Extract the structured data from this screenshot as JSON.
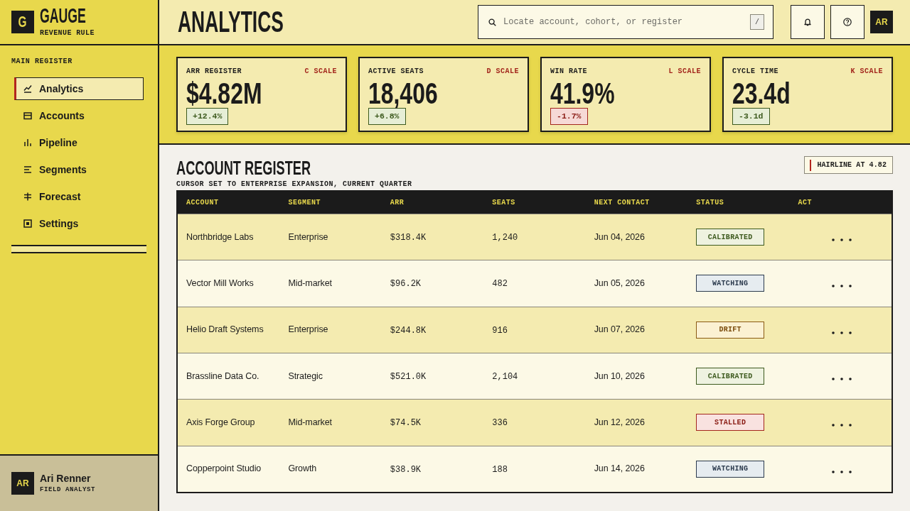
{
  "brand": {
    "logo_letter": "G",
    "name": "GAUGE",
    "tagline": "REVENUE RULE"
  },
  "sidebar": {
    "section_label": "MAIN REGISTER",
    "items": [
      {
        "label": "Analytics",
        "selected": true
      },
      {
        "label": "Accounts",
        "selected": false
      },
      {
        "label": "Pipeline",
        "selected": false
      },
      {
        "label": "Segments",
        "selected": false
      },
      {
        "label": "Forecast",
        "selected": false
      },
      {
        "label": "Settings",
        "selected": false
      }
    ]
  },
  "user": {
    "initials": "AR",
    "name": "Ari Renner",
    "role": "FIELD ANALYST"
  },
  "header": {
    "title": "ANALYTICS",
    "search": {
      "placeholder": "Locate account, cohort, or register",
      "shortcut": "/"
    },
    "avatar_initials": "AR"
  },
  "kpis": [
    {
      "label": "ARR REGISTER",
      "scale": "C SCALE",
      "value": "$4.82M",
      "delta": {
        "text": "+12.4%",
        "kind": "good"
      }
    },
    {
      "label": "ACTIVE SEATS",
      "scale": "D SCALE",
      "value": "18,406",
      "delta": {
        "text": "+6.8%",
        "kind": "good"
      }
    },
    {
      "label": "WIN RATE",
      "scale": "L SCALE",
      "value": "41.9%",
      "delta": {
        "text": "-1.7%",
        "kind": "bad"
      }
    },
    {
      "label": "CYCLE TIME",
      "scale": "K SCALE",
      "value": "23.4d",
      "delta": {
        "text": "-3.1d",
        "kind": "good"
      }
    }
  ],
  "register": {
    "title": "ACCOUNT REGISTER",
    "subtitle": "CURSOR SET TO ENTERPRISE EXPANSION, CURRENT QUARTER",
    "marker": "HAIRLINE AT 4.82",
    "columns": [
      "ACCOUNT",
      "SEGMENT",
      "ARR",
      "SEATS",
      "NEXT CONTACT",
      "STATUS",
      "ACT"
    ],
    "rows": [
      {
        "account": "Northbridge Labs",
        "segment": "Enterprise",
        "arr": "$318.4K",
        "seats": "1,240",
        "next_contact": "Jun 04, 2026",
        "status": {
          "label": "CALIBRATED",
          "kind": "good"
        }
      },
      {
        "account": "Vector Mill Works",
        "segment": "Mid-market",
        "arr": "$96.2K",
        "seats": "482",
        "next_contact": "Jun 05, 2026",
        "status": {
          "label": "WATCHING",
          "kind": "watch"
        }
      },
      {
        "account": "Helio Draft Systems",
        "segment": "Enterprise",
        "arr": "$244.8K",
        "seats": "916",
        "next_contact": "Jun 07, 2026",
        "status": {
          "label": "DRIFT",
          "kind": "warn"
        }
      },
      {
        "account": "Brassline Data Co.",
        "segment": "Strategic",
        "arr": "$521.0K",
        "seats": "2,104",
        "next_contact": "Jun 10, 2026",
        "status": {
          "label": "CALIBRATED",
          "kind": "good"
        }
      },
      {
        "account": "Axis Forge Group",
        "segment": "Mid-market",
        "arr": "$74.5K",
        "seats": "336",
        "next_contact": "Jun 12, 2026",
        "status": {
          "label": "STALLED",
          "kind": "bad"
        }
      },
      {
        "account": "Copperpoint Studio",
        "segment": "Growth",
        "arr": "$38.9K",
        "seats": "188",
        "next_contact": "Jun 14, 2026",
        "status": {
          "label": "WATCHING",
          "kind": "watch"
        }
      }
    ]
  }
}
